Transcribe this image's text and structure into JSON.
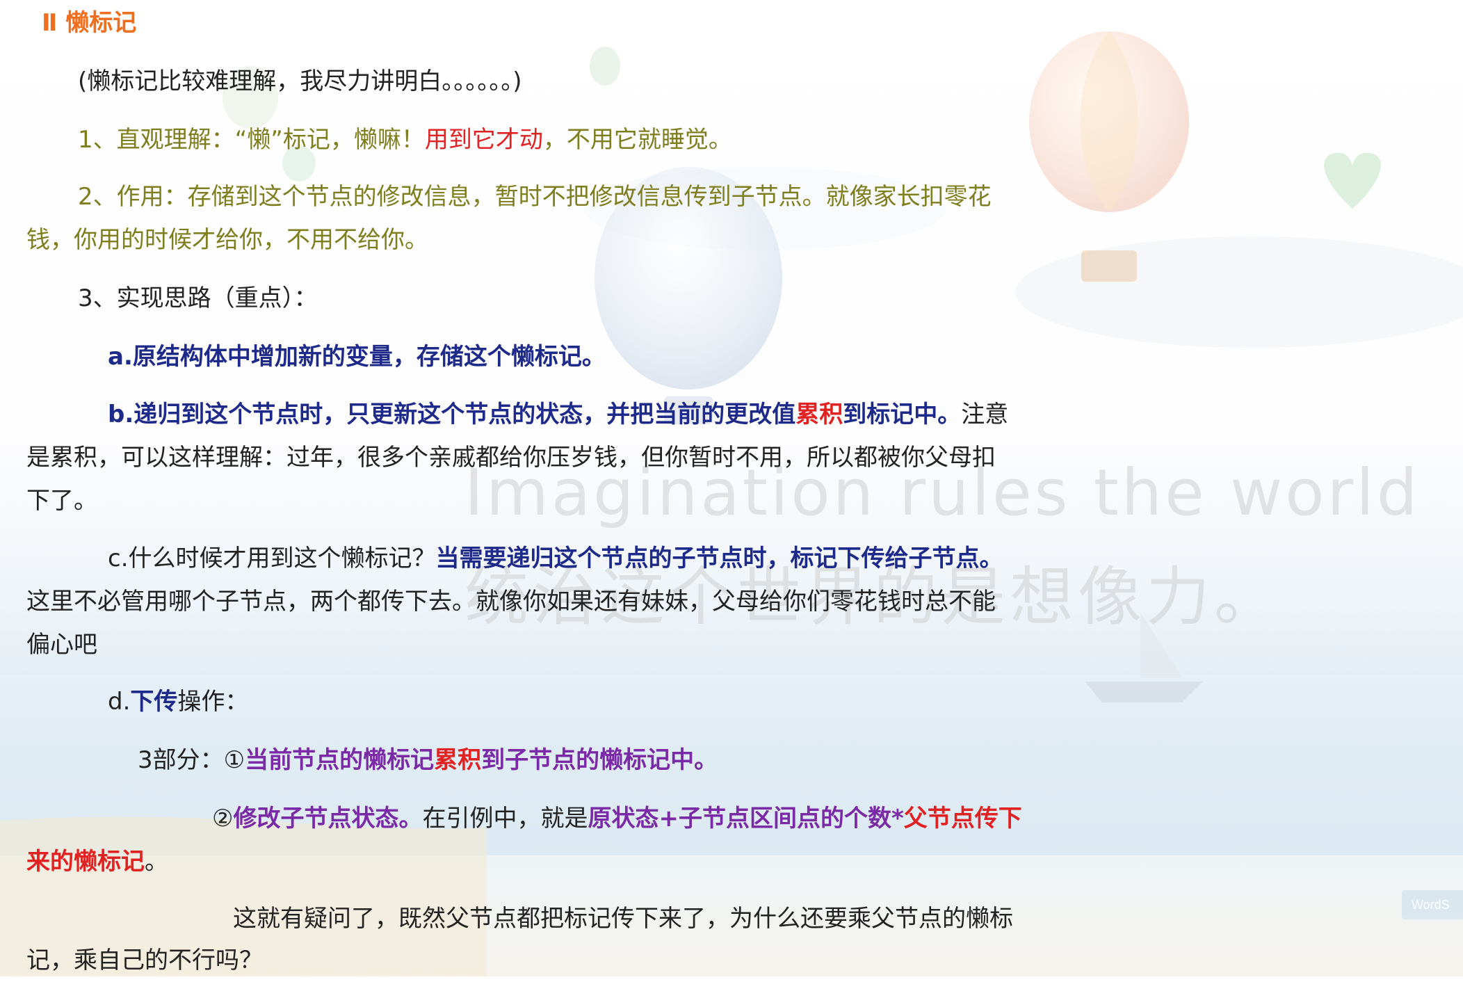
{
  "section": {
    "marker": "Ⅱ",
    "title": "懒标记"
  },
  "intro": "(懒标记比较难理解，我尽力讲明白。。。。。。)",
  "item1": {
    "prefix": "1、直观理解：“懒”标记，懒嘛！",
    "highlight": "用到它才动",
    "suffix": "，不用它就睡觉。"
  },
  "item2": {
    "line1": "2、作用：存储到这个节点的修改信息，暂时不把修改信息传到子节点。就像家长扣零花",
    "line2": "钱，你用的时候才给你，不用不给你。"
  },
  "item3": {
    "label": "3、实现思路（重点）："
  },
  "point_a": "a.原结构体中增加新的变量，存储这个懒标记。",
  "point_b": {
    "bold1": "b.递归到这个节点时，只更新这个节点的状态，并把当前的更改值",
    "red": "累积",
    "bold2": "到标记中。",
    "tail": "注意",
    "line2": "是累积，可以这样理解：过年，很多个亲戚都给你压岁钱，但你暂时不用，所以都被你父母扣",
    "line3": "下了。"
  },
  "point_c": {
    "plain": "c.什么时候才用到这个懒标记？",
    "bold": "当需要递归这个节点的子节点时，标记下传给子节点。",
    "line2": "这里不必管用哪个子节点，两个都传下去。就像你如果还有妹妹，父母给你们零花钱时总不能",
    "line3": "偏心吧"
  },
  "point_d": {
    "prefix": "d.",
    "bold": "下传",
    "suffix": "操作："
  },
  "part1": {
    "prefix": "3部分：①",
    "purple1": "当前节点的懒标记",
    "red": "累积",
    "purple2": "到子节点的懒标记中。"
  },
  "part2": {
    "circle": "②",
    "purple1": "修改子节点状态。",
    "plain": "在引例中，就是",
    "purple2": "原状态+子节点区间点的个数*",
    "red1": "父节点传下",
    "red2": "来的懒标记",
    "end": "。"
  },
  "question": {
    "line1": "这就有疑问了，既然父节点都把标记传下来了，为什么还要乘父节点的懒标",
    "line2": "记，乘自己的不行吗？"
  },
  "watermark": {
    "english": "Imagination rules the world",
    "chinese": "统治这个世界的是想像力。"
  },
  "badge": "WordS"
}
